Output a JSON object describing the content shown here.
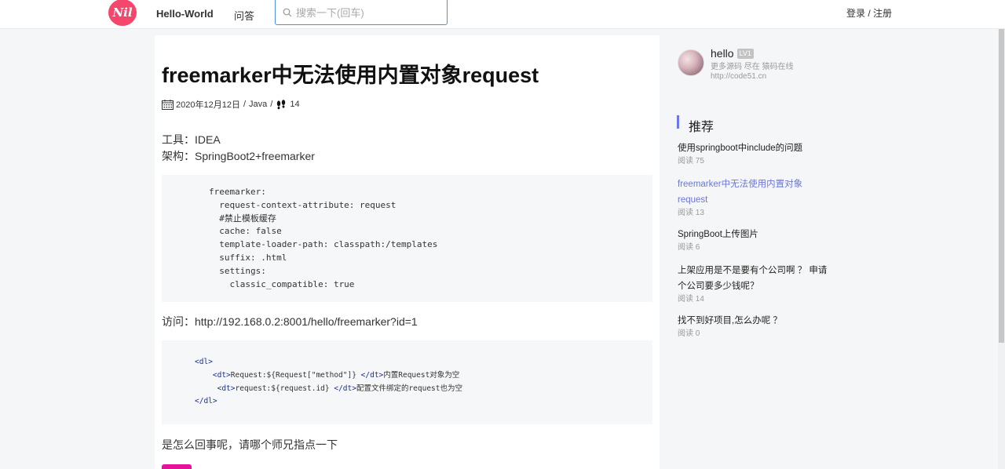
{
  "header": {
    "site_name": "Hello-World",
    "nav_ask": "问答",
    "search_placeholder": "搜索一下(回车)",
    "login": "登录",
    "auth_sep": "/",
    "register": "注册"
  },
  "article": {
    "title": "freemarker中无法使用内置对象request",
    "date": "2020年12月12日",
    "sep1": "/",
    "category": "Java",
    "sep2": "/",
    "views": "14",
    "para_tool": "工具：IDEA",
    "para_arch": "架构：SpringBoot2+freemarker",
    "code1": "freemarker:\n  request-context-attribute: request\n  #禁止模板缓存\n  cache: false\n  template-loader-path: classpath:/templates\n  suffix: .html\n  settings:\n    classic_compatible: true",
    "para_access": "访问：http://192.168.0.2:8001/hello/freemarker?id=1",
    "code2": {
      "l1_tag": "<dl>",
      "l2_open": "<dt>",
      "l2_text": "Request:${Request[\"method\"]} ",
      "l2_close": "</dt>",
      "l2_comment": "内置Request对象为空",
      "l3_open": "<dt>",
      "l3_text": "request:${request.id} ",
      "l3_close": "</dt>",
      "l3_comment": "配置文件绑定的request也为空",
      "l4_tag": "</dl>"
    },
    "para_question": "是怎么回事呢，请哪个师兄指点一下"
  },
  "sidebar": {
    "user": {
      "name": "hello",
      "level": "LV1",
      "bio": "更多源码 尽在 猿码在线",
      "url": "http://code51.cn"
    },
    "rec_title": "推荐",
    "recommendations": [
      {
        "title": "使用springboot中include的问题",
        "reads": "阅读 75"
      },
      {
        "title": "freemarker中无法使用内置对象request",
        "reads": "阅读 13"
      },
      {
        "title": "SpringBoot上传图片",
        "reads": "阅读 6"
      },
      {
        "title": "上架应用是不是要有个公司啊 ？ 申请个公司要多少钱呢？",
        "reads": "阅读 14"
      },
      {
        "title": "找不到好项目,怎么办呢 ？",
        "reads": "阅读 0"
      }
    ]
  },
  "colors": {
    "accent": "#6b76f0",
    "logo": "#f4476b",
    "pink_button": "#e6139a"
  }
}
